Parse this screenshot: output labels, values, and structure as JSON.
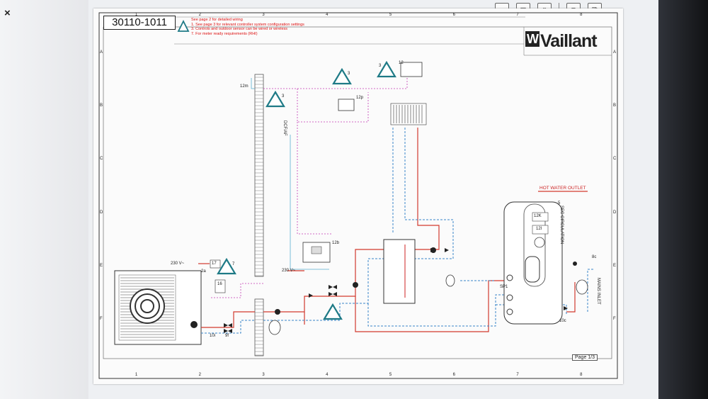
{
  "viewer": {
    "close_glyph": "×",
    "toolbar_icons": [
      "fit-page-icon",
      "zoom-in-icon",
      "single-page-icon",
      "menu-icon",
      "thumbnails-icon"
    ]
  },
  "drawing": {
    "code": "30110-1011",
    "notes": [
      "See page 2 for detailed wiring",
      "1.  See page 3 for relevant controller system configuration settings",
      "3.  Controls and outdoor sensor can be wired or wireless",
      "7.  For meter ready requirements (RHI)"
    ],
    "brand": "Vaillant",
    "brand_mark": "W",
    "grid_cols": [
      "1",
      "2",
      "3",
      "4",
      "5",
      "6",
      "7",
      "8"
    ],
    "grid_rows": [
      "A",
      "B",
      "C",
      "D",
      "E",
      "F"
    ],
    "labels": {
      "hot_water_outlet": "HOT WATER OUTLET",
      "sec_circulation": "SEC CIRCULATION",
      "mains_inlet": "MAINS INLET",
      "v230_a": "230 V~",
      "v230_b": "230 V~",
      "ref_12m": "12m",
      "ref_12": "12",
      "ref_12p": "12p",
      "ref_12b": "12b",
      "ref_17": "17",
      "ref_16": "16",
      "ref_2a": "2a",
      "ref_10i": "10i",
      "ref_9f": "9f",
      "ref_5": "5",
      "ref_12k": "12K",
      "ref_12i": "12I",
      "ref_10c": "10c",
      "ref_sp1": "SP1",
      "ref_8c": "8c",
      "ref_dcf": "DCF/AF",
      "ref_tri_3a": "3",
      "ref_tri_3b": "3",
      "ref_tri_3c": "3",
      "ref_tri_7": "7"
    },
    "page": "Page 1/3"
  },
  "colors": {
    "red_line": "#d23a2e",
    "blue_line": "#3a86c8",
    "magenta_line": "#c23ab3",
    "teal_warning": "#1e7a86",
    "notes_red": "#dd1111"
  }
}
